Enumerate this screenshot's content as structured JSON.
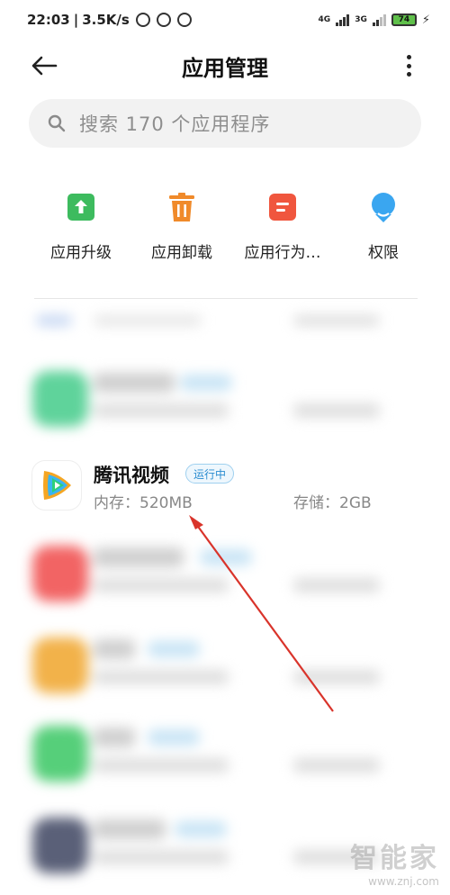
{
  "status_bar": {
    "time": "22:03",
    "speed": "3.5K/s",
    "net1": "4G",
    "net2": "3G",
    "battery": "74"
  },
  "header": {
    "title": "应用管理"
  },
  "search": {
    "placeholder": "搜索 170 个应用程序"
  },
  "actions": [
    {
      "label": "应用升级",
      "icon": "upgrade-icon",
      "color": "#3dbb5e"
    },
    {
      "label": "应用卸载",
      "icon": "trash-icon",
      "color": "#f08a2a"
    },
    {
      "label": "应用行为…",
      "icon": "behavior-icon",
      "color": "#f0563e"
    },
    {
      "label": "权限",
      "icon": "permission-icon",
      "color": "#3aa6f0"
    }
  ],
  "featured_app": {
    "name": "腾讯视频",
    "status": "运行中",
    "memory": "内存：520MB",
    "storage": "存储：2GB"
  },
  "watermark": {
    "brand": "智能家",
    "url": "www.znj.com"
  }
}
